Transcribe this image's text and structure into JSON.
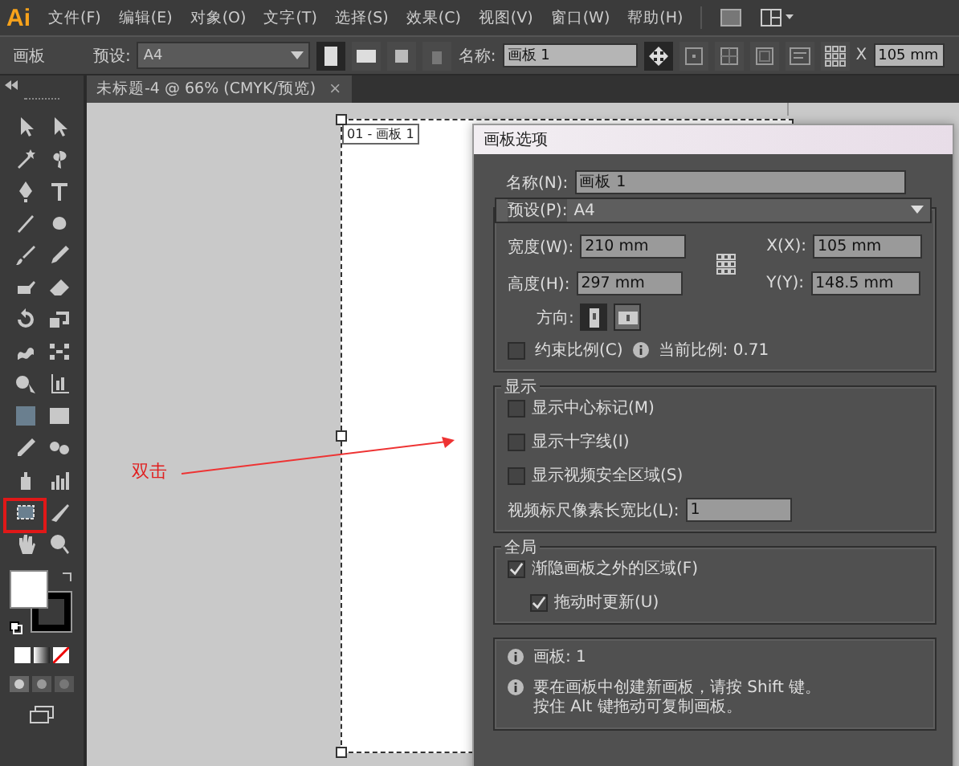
{
  "app": {
    "logo": "Ai",
    "menus": [
      "文件(F)",
      "编辑(E)",
      "对象(O)",
      "文字(T)",
      "选择(S)",
      "效果(C)",
      "视图(V)",
      "窗口(W)",
      "帮助(H)"
    ]
  },
  "control_bar": {
    "label": "画板",
    "preset_label": "预设:",
    "preset_value": "A4",
    "name_label": "名称:",
    "name_value": "画板 1",
    "x_label": "X",
    "x_value": "105 mm"
  },
  "document_tab": {
    "title": "未标题-4 @ 66% (CMYK/预览)",
    "close": "×"
  },
  "artboard": {
    "label": "01 - 画板 1"
  },
  "annotation": {
    "text": "双击"
  },
  "dialog": {
    "title": "画板选项",
    "name_label": "名称(N):",
    "name_value": "画板 1",
    "preset_label": "预设(P):",
    "preset_value": "A4",
    "width_label": "宽度(W):",
    "width_value": "210 mm",
    "height_label": "高度(H):",
    "height_value": "297 mm",
    "x_label": "X(X):",
    "x_value": "105 mm",
    "y_label": "Y(Y):",
    "y_value": "148.5 mm",
    "orientation_label": "方向:",
    "orientation": [
      {
        "kind": "portrait",
        "selected": true
      },
      {
        "kind": "landscape",
        "selected": false
      }
    ],
    "constrain": {
      "label": "约束比例(C)",
      "checked": false
    },
    "ratio": "当前比例: 0.71",
    "display": {
      "title": "显示",
      "options": [
        {
          "label": "显示中心标记(M)",
          "checked": false
        },
        {
          "label": "显示十字线(I)",
          "checked": false
        },
        {
          "label": "显示视频安全区域(S)",
          "checked": false
        }
      ],
      "pixel_label": "视频标尺像素长宽比(L):",
      "pixel_value": "1"
    },
    "global": {
      "title": "全局",
      "options": [
        {
          "label": "渐隐画板之外的区域(F)",
          "checked": true,
          "children": [
            {
              "label": "拖动时更新(U)",
              "checked": true
            }
          ]
        }
      ]
    },
    "info": [
      "画板: 1",
      "要在画板中创建新画板，请按 Shift 键。按住 Alt 键拖动可复制画板。"
    ]
  }
}
